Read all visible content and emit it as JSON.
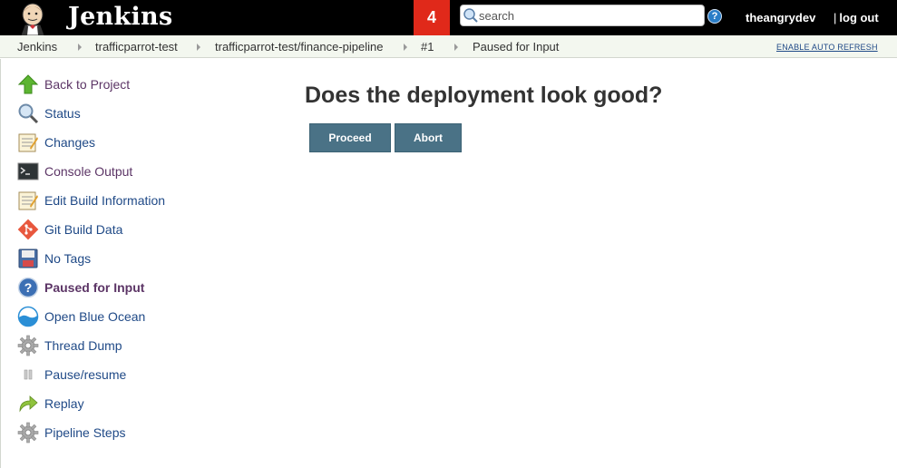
{
  "header": {
    "logo_text": "Jenkins",
    "notification_count": "4",
    "search_placeholder": "search",
    "help_icon": "?",
    "username": "theangrydev",
    "logout_separator": "|",
    "logout_label": "log out",
    "notification_color": "#e0291a"
  },
  "breadcrumb": {
    "items": [
      "Jenkins",
      "trafficparrot-test",
      "trafficparrot-test/finance-pipeline",
      "#1",
      "Paused for Input"
    ],
    "auto_refresh": "ENABLE AUTO REFRESH"
  },
  "sidebar": {
    "items": [
      {
        "label": "Back to Project",
        "icon": "up-arrow-icon"
      },
      {
        "label": "Status",
        "icon": "magnifier-icon"
      },
      {
        "label": "Changes",
        "icon": "notepad-icon"
      },
      {
        "label": "Console Output",
        "icon": "terminal-icon"
      },
      {
        "label": "Edit Build Information",
        "icon": "notepad-icon"
      },
      {
        "label": "Git Build Data",
        "icon": "git-icon"
      },
      {
        "label": "No Tags",
        "icon": "floppy-disk-icon"
      },
      {
        "label": "Paused for Input",
        "icon": "help-circle-icon"
      },
      {
        "label": "Open Blue Ocean",
        "icon": "blue-ocean-icon"
      },
      {
        "label": "Thread Dump",
        "icon": "gear-icon"
      },
      {
        "label": "Pause/resume",
        "icon": "pause-icon"
      },
      {
        "label": "Replay",
        "icon": "replay-arrow-icon"
      },
      {
        "label": "Pipeline Steps",
        "icon": "gear-icon"
      }
    ]
  },
  "main": {
    "title": "Does the deployment look good?",
    "proceed_label": "Proceed",
    "abort_label": "Abort",
    "button_color": "#4a7286"
  }
}
